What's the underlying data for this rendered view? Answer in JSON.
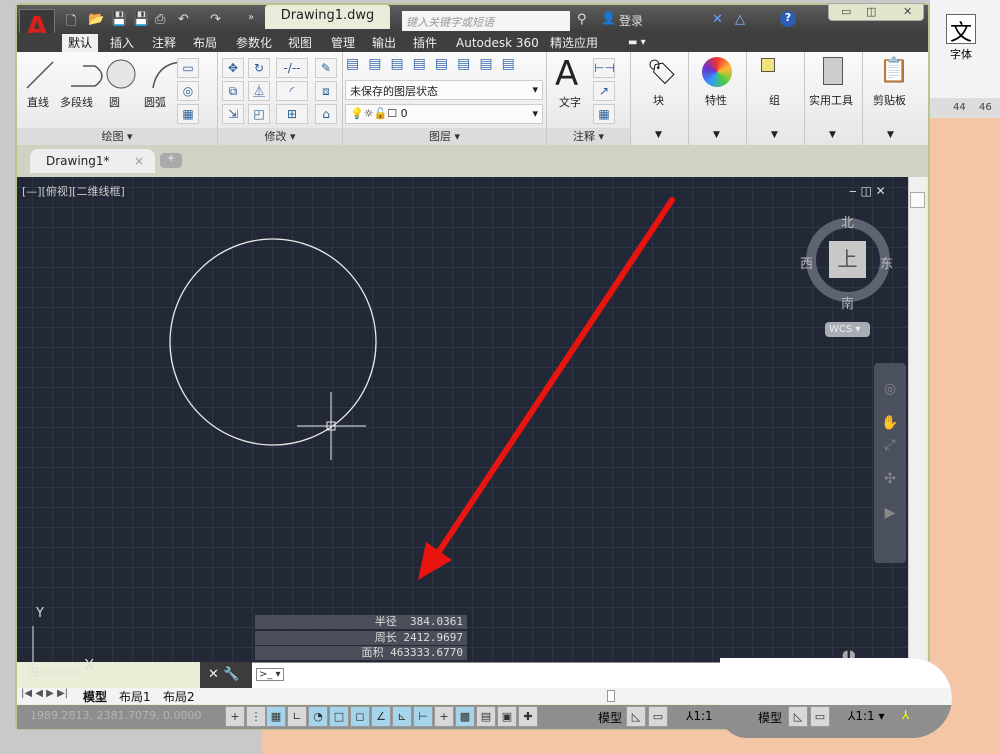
{
  "title_bar": {
    "document_title": "Drawing1.dwg",
    "search_placeholder": "键入关键字或短语",
    "login_label": "登录",
    "quick_access": [
      "new-icon",
      "open-icon",
      "save-icon",
      "saveas-icon",
      "plot-icon",
      "undo-icon",
      "redo-icon"
    ]
  },
  "ribbon_tabs": [
    "默认",
    "插入",
    "注释",
    "布局",
    "参数化",
    "视图",
    "管理",
    "输出",
    "插件",
    "Autodesk 360",
    "精选应用"
  ],
  "ribbon": {
    "draw": {
      "title": "绘图",
      "tools": [
        "直线",
        "多段线",
        "圆",
        "圆弧"
      ]
    },
    "modify": {
      "title": "修改"
    },
    "layers": {
      "title": "图层",
      "layer_state": "未保存的图层状态",
      "current_layer": "0"
    },
    "annotation": {
      "title": "注释",
      "text_tool": "文字"
    },
    "big_tools": [
      "块",
      "特性",
      "组",
      "实用工具",
      "剪贴板"
    ]
  },
  "document_tabs": [
    {
      "label": "Drawing1*"
    }
  ],
  "viewport": {
    "label": "[—][俯视][二维线框]",
    "viewcube": {
      "north": "北",
      "south": "南",
      "east": "东",
      "west": "西",
      "face": "上",
      "ucs": "WCS"
    },
    "axis_x": "X",
    "axis_y": "Y"
  },
  "tooltip": {
    "rows": [
      {
        "label": "半径",
        "value": "384.0361"
      },
      {
        "label": "周长",
        "value": "2412.9697"
      },
      {
        "label": "面积",
        "value": "463333.6770"
      }
    ]
  },
  "layout_tabs": [
    "模型",
    "布局1",
    "布局2"
  ],
  "status_bar": {
    "coordinates": "1989.2813, 2381.7079, 0.0000",
    "model_label": "模型",
    "scale": "1:1"
  },
  "background_app": {
    "font_label": "字体",
    "ruler": [
      "44",
      "46"
    ]
  },
  "colors": {
    "viewport_bg": "#222835",
    "arrow": "#e8140f",
    "accent_red": "#d3231c"
  }
}
